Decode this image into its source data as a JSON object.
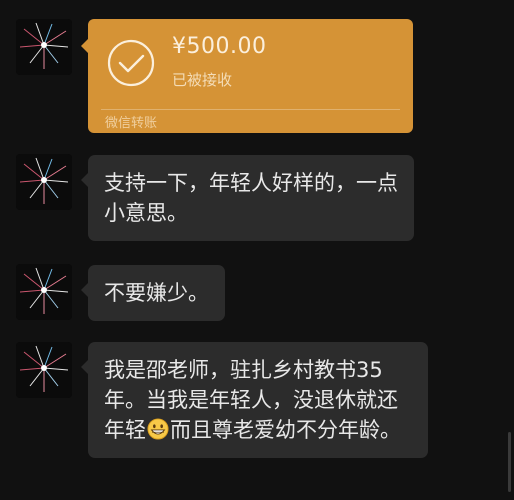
{
  "transfer": {
    "amount": "¥500.00",
    "status": "已被接收",
    "label": "微信转账",
    "icon": "check-circle-icon",
    "color": "#d59336"
  },
  "messages": [
    {
      "text": "支持一下，年轻人好样的，一点小意思。"
    },
    {
      "text": "不要嫌少。"
    },
    {
      "text_before_emoji": "我是邵老师，驻扎乡村教书35年。当我是年轻人，没退休就还年轻",
      "emoji": "grinning-face-icon",
      "text_after_emoji": "而且尊老爱幼不分年龄。"
    }
  ],
  "avatar": {
    "icon": "fireworks-avatar-icon"
  },
  "colors": {
    "background": "#111111",
    "bubble": "#2c2c2c",
    "text": "#e8e8e8"
  }
}
